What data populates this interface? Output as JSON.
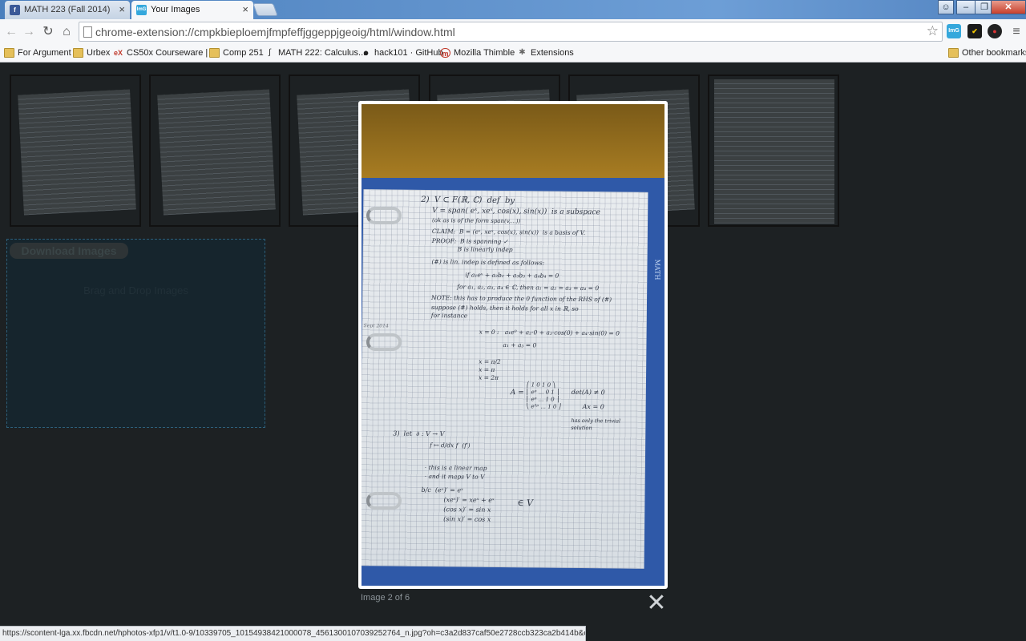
{
  "tabs": [
    {
      "title": "MATH 223 (Fall 2014)",
      "icon": "facebook-icon",
      "icon_text": "f",
      "color": "#3b5998"
    },
    {
      "title": "Your Images",
      "icon": "img-extension-icon",
      "icon_text": "ImG",
      "color": "#35a8dc"
    }
  ],
  "tab_close": "×",
  "address": {
    "url": "chrome-extension://cmpkbieploemjfmpfeffjggeppjgeoig/html/window.html"
  },
  "bookmarks": [
    {
      "label": "For Argument",
      "icon": "folder-icon"
    },
    {
      "label": "Urbex",
      "icon": "folder-icon"
    },
    {
      "label": "CS50x Courseware | ...",
      "icon": "edx-icon",
      "icon_text": "eX"
    },
    {
      "label": "Comp 251",
      "icon": "folder-icon"
    },
    {
      "label": "MATH 222: Calculus...",
      "icon": "integral-icon",
      "icon_text": "∫"
    },
    {
      "label": "hack101 · GitHub",
      "icon": "github-icon",
      "icon_text": "●"
    },
    {
      "label": "Mozilla Thimble",
      "icon": "thimble-icon",
      "icon_text": "m"
    },
    {
      "label": "Extensions",
      "icon": "puzzle-icon",
      "icon_text": "✱"
    }
  ],
  "other_bookmarks": "Other bookmarks",
  "gallery": {
    "download_label": "Download Images",
    "drop_label": "Brag and Drop Images"
  },
  "lightbox": {
    "caption": "Image 2 of 6",
    "close": "✕",
    "handwriting": {
      "line1": "2)  V ⊂ F(ℝ, ℂ)  def  by",
      "line2": "V = span( eˣ, xeˣ, cos(x), sin(x))  is a subspace",
      "line3": "(ok as is of the form span(v,...))",
      "line4": "CLAIM:  B = (eˣ, xeˣ, cos(x), sin(x))  is a basis of V.",
      "line5": "PROOF:  B is spanning ✓",
      "line6": "B is linearly indep",
      "line7": "(#) is lin. indep is defined as follows:",
      "line8": "if a₁eˣ + a₂b₂ + a₃b₃ + a₄b₄ = 0",
      "line9": "for a₁, a₂, a₃, a₄ ∈ ℂ, then a₁ = a₂ = a₃ = a₄ = 0",
      "line10": "NOTE: this has to produce the 0 function of the RHS of (#)",
      "line11": "suppose (#) holds, then it holds for all x in ℝ, so",
      "line12": "for instance",
      "line13": "x = 0 :   a₁e⁰ + a₂·0 + a₃·cos(0) + a₄·sin(0) = 0",
      "line14": "a₁ + a₃ = 0",
      "line15": "x = π/2",
      "line16": "x = π",
      "line17": "x = 2π",
      "line18": "A =",
      "line19": "det(A) ≠ 0",
      "line20": "Ax = 0",
      "line21": "has only the trivial solution",
      "line22": "3)  let  ∂ : V → V",
      "line23": "f ↦ d/dx f  (f′)",
      "line24": "· this is a linear map",
      "line25": "· and it maps V to V",
      "line26": "b/c  (eˣ)′ = eˣ",
      "line27": "(xeˣ)′ = xeˣ + eˣ",
      "line28": "(cos x)′ = sin x",
      "line29": "(sin x)′ = cos x",
      "line30": "∈ V",
      "margin": "Sept 2014",
      "tab": "MATH"
    }
  },
  "status_url": "https://scontent-lga.xx.fbcdn.net/hphotos-xfp1/v/t1.0-9/10339705_10154938421000078_4561300107039252764_n.jpg?oh=c3a2d837caf50e2728ccb323ca2b414b&oe=554E2421"
}
